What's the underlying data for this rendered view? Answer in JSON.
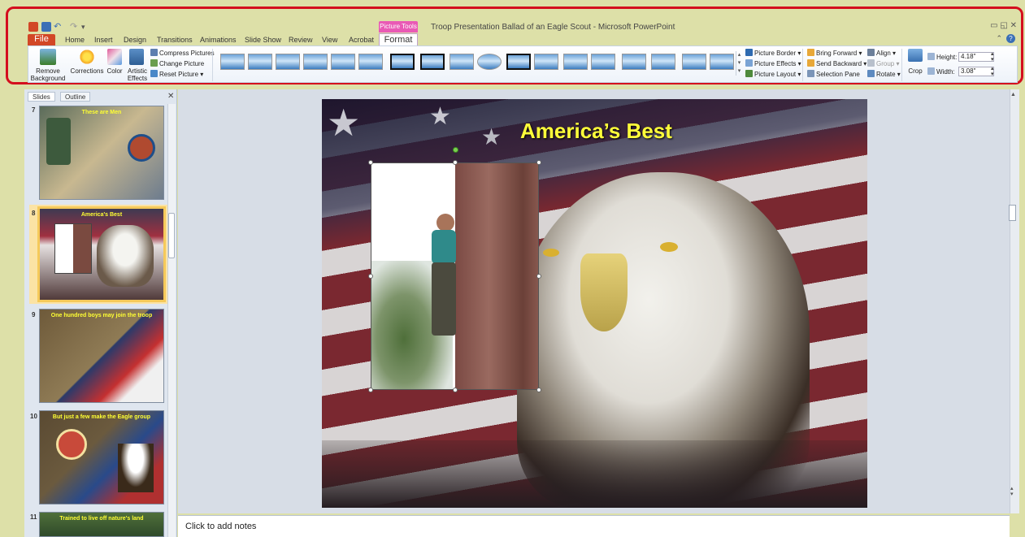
{
  "window": {
    "title": "Troop Presentation Ballad of an Eagle Scout - Microsoft PowerPoint",
    "contextual_tab": "Picture Tools",
    "controls": "▭ ◱ ✕"
  },
  "tabs": [
    "File",
    "Home",
    "Insert",
    "Design",
    "Transitions",
    "Animations",
    "Slide Show",
    "Review",
    "View",
    "Acrobat",
    "Format"
  ],
  "ribbon": {
    "adjust": {
      "remove_background": "Remove\nBackground",
      "corrections": "Corrections",
      "color": "Color",
      "artistic_effects": "Artistic\nEffects",
      "compress_pictures": "Compress Pictures",
      "change_picture": "Change Picture",
      "reset_picture": "Reset Picture"
    },
    "picture_styles_count": 17,
    "picture_border": "Picture Border",
    "picture_effects": "Picture Effects",
    "picture_layout": "Picture Layout",
    "arrange": {
      "bring_forward": "Bring Forward",
      "send_backward": "Send Backward",
      "selection_pane": "Selection Pane",
      "align": "Align",
      "group": "Group",
      "rotate": "Rotate"
    },
    "size": {
      "crop": "Crop",
      "height_label": "Height:",
      "height_value": "4.18\"",
      "width_label": "Width:",
      "width_value": "3.08\""
    }
  },
  "pane": {
    "tabs": [
      "Slides",
      "Outline"
    ],
    "close": "✕",
    "slides": [
      {
        "num": "7",
        "title": "These are Men"
      },
      {
        "num": "8",
        "title": "America's Best"
      },
      {
        "num": "9",
        "title": "One hundred boys may join the troop"
      },
      {
        "num": "10",
        "title": "But just a few make the Eagle group"
      },
      {
        "num": "11",
        "title": "Trained to live off nature's land"
      }
    ]
  },
  "slide": {
    "title": "America’s Best"
  },
  "notes": {
    "placeholder": "Click to add notes"
  },
  "colors": {
    "file_tab": "#d24726",
    "picture_tools": "#e95ab5",
    "annotation_frame": "#d40f1e",
    "slide_title": "#ffff3a"
  }
}
